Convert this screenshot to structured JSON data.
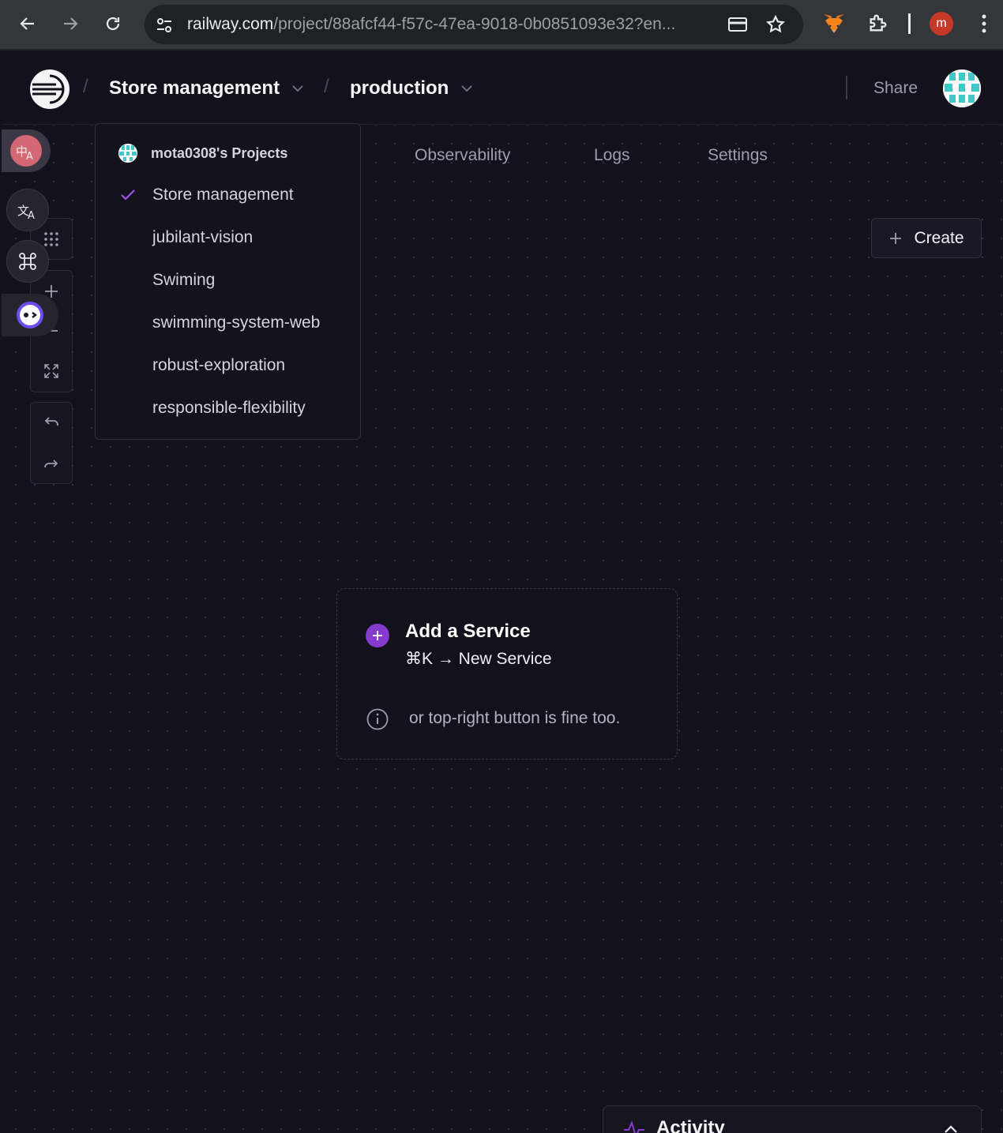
{
  "browser": {
    "url_host": "railway.com",
    "url_path": "/project/88afcf44-f57c-47ea-9018-0b0851093e32?en...",
    "profile_initial": "m"
  },
  "header": {
    "project_name": "Store management",
    "environment": "production",
    "share_label": "Share"
  },
  "tabs": [
    {
      "label": "Observability"
    },
    {
      "label": "Logs"
    },
    {
      "label": "Settings"
    }
  ],
  "create_button": {
    "label": "Create"
  },
  "project_dropdown": {
    "heading": "mota0308's Projects",
    "selected": "Store management",
    "items": [
      {
        "label": "Store management"
      },
      {
        "label": "jubilant-vision"
      },
      {
        "label": "Swiming"
      },
      {
        "label": "swimming-system-web"
      },
      {
        "label": "robust-exploration"
      },
      {
        "label": "responsible-flexibility"
      }
    ]
  },
  "service_card": {
    "title": "Add a Service",
    "shortcut": "⌘K → New Service",
    "note": "or top-right button is fine too."
  },
  "activity": {
    "label": "Activity"
  },
  "colors": {
    "background": "#13111c",
    "accent_purple": "#853bce",
    "check_purple": "#a855f7",
    "text_muted": "#a09cae"
  }
}
